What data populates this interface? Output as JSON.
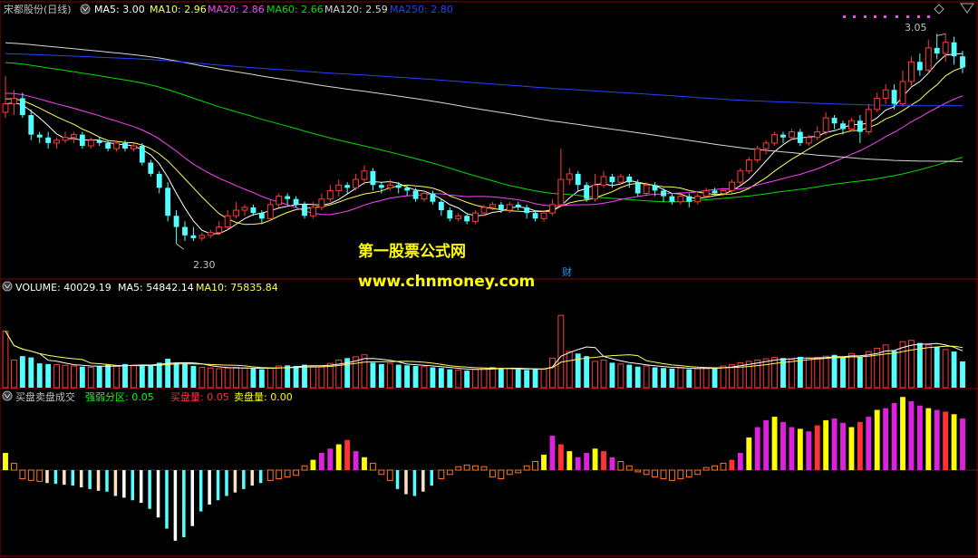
{
  "colors": {
    "up": "#ff3b3b",
    "down": "#54ffff",
    "ma5": "#ffffff",
    "ma10": "#ffff55",
    "ma20": "#ff44ff",
    "ma60": "#00e000",
    "ma120": "#d8d8d8",
    "ma250": "#2244ff",
    "grid": "#8b0000",
    "label": "#c0c0c0",
    "strong": "#00ff00",
    "buy": "#ff3333",
    "sell": "#ffff00",
    "vol_text": "#ffffff"
  },
  "price_panel": {
    "stock_name": "宋都股份(日线)",
    "ma5_label": "MA5: 3.00",
    "ma10_label": "MA10: 2.96",
    "ma20_label": "MA20: 2.86",
    "ma60_label": "MA60: 2.66",
    "ma120_label": "MA120: 2.59",
    "ma250_label": "MA250: 2.80",
    "high_label": "3.05",
    "low_label": "2.30",
    "event_marker": "财"
  },
  "watermark": {
    "line1": "第一股票公式网",
    "line2": "www.chnmoney.com"
  },
  "volume_panel": {
    "volume_label": "VOLUME: 40029.19",
    "ma5_label": "MA5: 54842.14",
    "ma10_label": "MA10: 75835.84"
  },
  "indicator_panel": {
    "name": "买盘卖盘成交",
    "strong_label": "强弱分区: 0.05",
    "buy_label": "买盘量: 0.05",
    "sell_label": "卖盘量: 0.00"
  },
  "chart_data": [
    {
      "type": "candlestick",
      "title": "宋都股份(日线)",
      "y_axis_ylim": [
        2.2,
        3.1
      ],
      "annotations": [
        {
          "text": "3.05",
          "value": 3.05
        },
        {
          "text": "2.30",
          "value": 2.3
        }
      ],
      "candles": [
        [
          2.77,
          2.8,
          2.75,
          2.9
        ],
        [
          2.8,
          2.82,
          2.76,
          2.85
        ],
        [
          2.82,
          2.76,
          2.75,
          2.84
        ],
        [
          2.76,
          2.69,
          2.67,
          2.78
        ],
        [
          2.69,
          2.68,
          2.66,
          2.7
        ],
        [
          2.68,
          2.66,
          2.64,
          2.7
        ],
        [
          2.66,
          2.67,
          2.64,
          2.68
        ],
        [
          2.67,
          2.68,
          2.66,
          2.7
        ],
        [
          2.68,
          2.69,
          2.66,
          2.7
        ],
        [
          2.69,
          2.65,
          2.64,
          2.7
        ],
        [
          2.65,
          2.67,
          2.64,
          2.68
        ],
        [
          2.67,
          2.66,
          2.65,
          2.68
        ],
        [
          2.66,
          2.64,
          2.63,
          2.67
        ],
        [
          2.64,
          2.66,
          2.63,
          2.67
        ],
        [
          2.66,
          2.64,
          2.63,
          2.67
        ],
        [
          2.64,
          2.65,
          2.63,
          2.66
        ],
        [
          2.65,
          2.59,
          2.58,
          2.66
        ],
        [
          2.59,
          2.55,
          2.54,
          2.6
        ],
        [
          2.55,
          2.5,
          2.48,
          2.56
        ],
        [
          2.5,
          2.4,
          2.38,
          2.52
        ],
        [
          2.4,
          2.36,
          2.3,
          2.42
        ],
        [
          2.36,
          2.33,
          2.31,
          2.38
        ],
        [
          2.33,
          2.32,
          2.31,
          2.36
        ],
        [
          2.32,
          2.33,
          2.31,
          2.34
        ],
        [
          2.33,
          2.34,
          2.32,
          2.35
        ],
        [
          2.34,
          2.36,
          2.33,
          2.38
        ],
        [
          2.36,
          2.4,
          2.35,
          2.42
        ],
        [
          2.4,
          2.42,
          2.39,
          2.45
        ],
        [
          2.42,
          2.43,
          2.4,
          2.44
        ],
        [
          2.43,
          2.41,
          2.4,
          2.44
        ],
        [
          2.41,
          2.39,
          2.37,
          2.42
        ],
        [
          2.39,
          2.44,
          2.38,
          2.46
        ],
        [
          2.44,
          2.47,
          2.43,
          2.48
        ],
        [
          2.47,
          2.46,
          2.44,
          2.48
        ],
        [
          2.46,
          2.44,
          2.43,
          2.47
        ],
        [
          2.44,
          2.4,
          2.39,
          2.45
        ],
        [
          2.4,
          2.43,
          2.39,
          2.45
        ],
        [
          2.43,
          2.46,
          2.42,
          2.48
        ],
        [
          2.46,
          2.49,
          2.45,
          2.51
        ],
        [
          2.49,
          2.51,
          2.47,
          2.53
        ],
        [
          2.51,
          2.5,
          2.48,
          2.52
        ],
        [
          2.5,
          2.53,
          2.49,
          2.55
        ],
        [
          2.53,
          2.56,
          2.51,
          2.58
        ],
        [
          2.56,
          2.51,
          2.49,
          2.57
        ],
        [
          2.51,
          2.5,
          2.48,
          2.52
        ],
        [
          2.5,
          2.51,
          2.49,
          2.53
        ],
        [
          2.51,
          2.5,
          2.48,
          2.52
        ],
        [
          2.5,
          2.49,
          2.47,
          2.51
        ],
        [
          2.49,
          2.46,
          2.45,
          2.5
        ],
        [
          2.46,
          2.48,
          2.45,
          2.49
        ],
        [
          2.48,
          2.45,
          2.44,
          2.49
        ],
        [
          2.45,
          2.42,
          2.4,
          2.46
        ],
        [
          2.42,
          2.39,
          2.38,
          2.43
        ],
        [
          2.39,
          2.4,
          2.38,
          2.41
        ],
        [
          2.4,
          2.38,
          2.37,
          2.41
        ],
        [
          2.38,
          2.41,
          2.37,
          2.42
        ],
        [
          2.41,
          2.43,
          2.4,
          2.44
        ],
        [
          2.43,
          2.44,
          2.42,
          2.45
        ],
        [
          2.44,
          2.42,
          2.41,
          2.45
        ],
        [
          2.42,
          2.44,
          2.41,
          2.45
        ],
        [
          2.44,
          2.43,
          2.42,
          2.45
        ],
        [
          2.43,
          2.41,
          2.39,
          2.44
        ],
        [
          2.41,
          2.39,
          2.38,
          2.42
        ],
        [
          2.39,
          2.41,
          2.38,
          2.42
        ],
        [
          2.41,
          2.44,
          2.4,
          2.46
        ],
        [
          2.44,
          2.53,
          2.43,
          2.64
        ],
        [
          2.53,
          2.55,
          2.51,
          2.57
        ],
        [
          2.55,
          2.51,
          2.49,
          2.56
        ],
        [
          2.51,
          2.46,
          2.45,
          2.52
        ],
        [
          2.46,
          2.51,
          2.45,
          2.55
        ],
        [
          2.51,
          2.54,
          2.5,
          2.56
        ],
        [
          2.54,
          2.52,
          2.5,
          2.55
        ],
        [
          2.52,
          2.54,
          2.51,
          2.55
        ],
        [
          2.54,
          2.52,
          2.5,
          2.55
        ],
        [
          2.52,
          2.48,
          2.47,
          2.53
        ],
        [
          2.48,
          2.51,
          2.47,
          2.52
        ],
        [
          2.51,
          2.49,
          2.47,
          2.52
        ],
        [
          2.49,
          2.47,
          2.45,
          2.5
        ],
        [
          2.47,
          2.45,
          2.44,
          2.48
        ],
        [
          2.45,
          2.47,
          2.44,
          2.48
        ],
        [
          2.47,
          2.45,
          2.43,
          2.48
        ],
        [
          2.45,
          2.47,
          2.44,
          2.48
        ],
        [
          2.47,
          2.49,
          2.46,
          2.5
        ],
        [
          2.49,
          2.48,
          2.47,
          2.5
        ],
        [
          2.48,
          2.49,
          2.47,
          2.5
        ],
        [
          2.49,
          2.52,
          2.48,
          2.53
        ],
        [
          2.52,
          2.56,
          2.51,
          2.57
        ],
        [
          2.56,
          2.6,
          2.55,
          2.61
        ],
        [
          2.6,
          2.64,
          2.59,
          2.65
        ],
        [
          2.64,
          2.66,
          2.62,
          2.67
        ],
        [
          2.66,
          2.69,
          2.65,
          2.7
        ],
        [
          2.69,
          2.68,
          2.66,
          2.7
        ],
        [
          2.68,
          2.7,
          2.67,
          2.71
        ],
        [
          2.7,
          2.66,
          2.65,
          2.71
        ],
        [
          2.66,
          2.68,
          2.65,
          2.69
        ],
        [
          2.68,
          2.7,
          2.67,
          2.72
        ],
        [
          2.7,
          2.75,
          2.69,
          2.77
        ],
        [
          2.75,
          2.73,
          2.71,
          2.76
        ],
        [
          2.73,
          2.71,
          2.69,
          2.74
        ],
        [
          2.71,
          2.74,
          2.7,
          2.75
        ],
        [
          2.74,
          2.7,
          2.66,
          2.76
        ],
        [
          2.7,
          2.78,
          2.69,
          2.8
        ],
        [
          2.78,
          2.82,
          2.77,
          2.84
        ],
        [
          2.82,
          2.85,
          2.8,
          2.87
        ],
        [
          2.85,
          2.8,
          2.78,
          2.87
        ],
        [
          2.8,
          2.88,
          2.79,
          2.92
        ],
        [
          2.88,
          2.95,
          2.86,
          2.97
        ],
        [
          2.95,
          2.92,
          2.9,
          2.98
        ],
        [
          2.92,
          3.0,
          2.91,
          3.03
        ],
        [
          3.0,
          2.98,
          2.96,
          3.05
        ],
        [
          2.98,
          3.02,
          2.95,
          3.05
        ],
        [
          3.02,
          2.97,
          2.94,
          3.04
        ],
        [
          2.97,
          2.93,
          2.91,
          2.99
        ]
      ]
    },
    {
      "type": "bar",
      "title": "VOLUME",
      "ylim": [
        0,
        135000
      ],
      "values": [
        86000,
        42000,
        48000,
        46000,
        37000,
        36000,
        35000,
        34000,
        33000,
        32000,
        31000,
        33000,
        35000,
        33000,
        36000,
        34000,
        35000,
        34000,
        38000,
        44000,
        38000,
        36000,
        33000,
        31000,
        30000,
        29000,
        30000,
        31000,
        30000,
        29000,
        28000,
        30000,
        33000,
        34000,
        33000,
        35000,
        32000,
        33000,
        37000,
        42000,
        45000,
        47000,
        50000,
        38000,
        36000,
        37000,
        35000,
        34000,
        33000,
        32000,
        31000,
        30000,
        28000,
        27000,
        26000,
        28000,
        30000,
        31000,
        30000,
        29000,
        28000,
        27000,
        29000,
        28000,
        45000,
        110000,
        55000,
        52000,
        48000,
        40000,
        42000,
        38000,
        36000,
        35000,
        32000,
        33000,
        31000,
        30000,
        29000,
        30000,
        28000,
        29000,
        30000,
        31000,
        33000,
        35000,
        38000,
        40000,
        42000,
        44000,
        46000,
        45000,
        43000,
        47000,
        45000,
        46000,
        48000,
        50000,
        46000,
        52000,
        47000,
        55000,
        60000,
        65000,
        56000,
        70000,
        72000,
        68000,
        65000,
        62000,
        58000,
        55000,
        40029
      ]
    },
    {
      "type": "bar",
      "title": "买盘卖盘成交",
      "ylim": [
        -1.0,
        1.0
      ],
      "values": [
        0.2,
        0.08,
        -0.1,
        -0.12,
        -0.13,
        -0.15,
        -0.16,
        -0.17,
        -0.18,
        -0.2,
        -0.22,
        -0.24,
        -0.25,
        -0.3,
        -0.32,
        -0.35,
        -0.38,
        -0.45,
        -0.55,
        -0.68,
        -0.82,
        -0.78,
        -0.65,
        -0.48,
        -0.4,
        -0.35,
        -0.3,
        -0.26,
        -0.22,
        -0.18,
        -0.15,
        -0.12,
        -0.1,
        -0.08,
        -0.06,
        0.05,
        0.12,
        0.2,
        0.25,
        0.3,
        0.35,
        0.22,
        0.15,
        0.08,
        -0.05,
        -0.12,
        -0.22,
        -0.28,
        -0.3,
        -0.25,
        -0.18,
        -0.1,
        -0.05,
        0.04,
        0.06,
        0.05,
        0.04,
        -0.08,
        -0.1,
        -0.05,
        -0.03,
        0.05,
        0.1,
        0.18,
        0.4,
        0.3,
        0.22,
        0.15,
        0.2,
        0.25,
        0.22,
        0.15,
        0.1,
        0.05,
        -0.02,
        -0.05,
        -0.08,
        -0.1,
        -0.12,
        -0.1,
        -0.08,
        -0.05,
        0.03,
        0.05,
        0.08,
        0.12,
        0.2,
        0.38,
        0.5,
        0.58,
        0.62,
        0.56,
        0.5,
        0.48,
        0.45,
        0.52,
        0.58,
        0.6,
        0.55,
        0.5,
        0.56,
        0.62,
        0.7,
        0.72,
        0.78,
        0.85,
        0.8,
        0.75,
        0.72,
        0.7,
        0.68,
        0.65,
        0.6
      ]
    }
  ]
}
